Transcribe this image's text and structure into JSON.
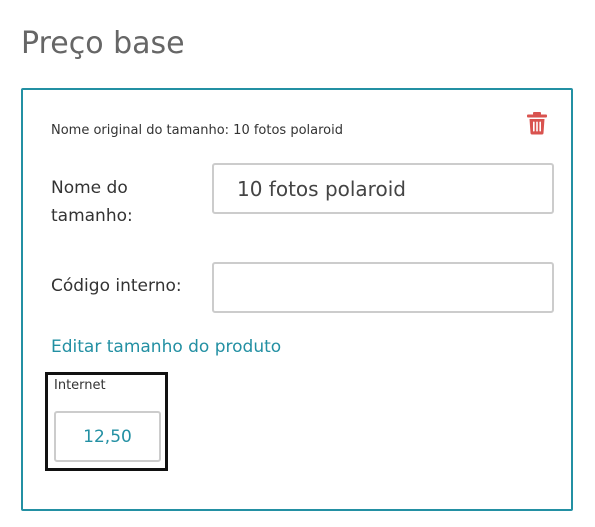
{
  "page": {
    "title": "Preço base"
  },
  "size_card": {
    "original_name": "Nome original do tamanho: 10 fotos polaroid",
    "delete_icon": "trash-icon",
    "name_label": "Nome do tamanho:",
    "name_value": "10 fotos polaroid",
    "code_label": "Código interno:",
    "code_value": "",
    "edit_link": "Editar tamanho do produto",
    "price_channel": {
      "label": "Internet",
      "value": "12,50"
    }
  },
  "colors": {
    "accent": "#2390a3",
    "delete": "#d9534f",
    "highlight_border": "#111111"
  }
}
